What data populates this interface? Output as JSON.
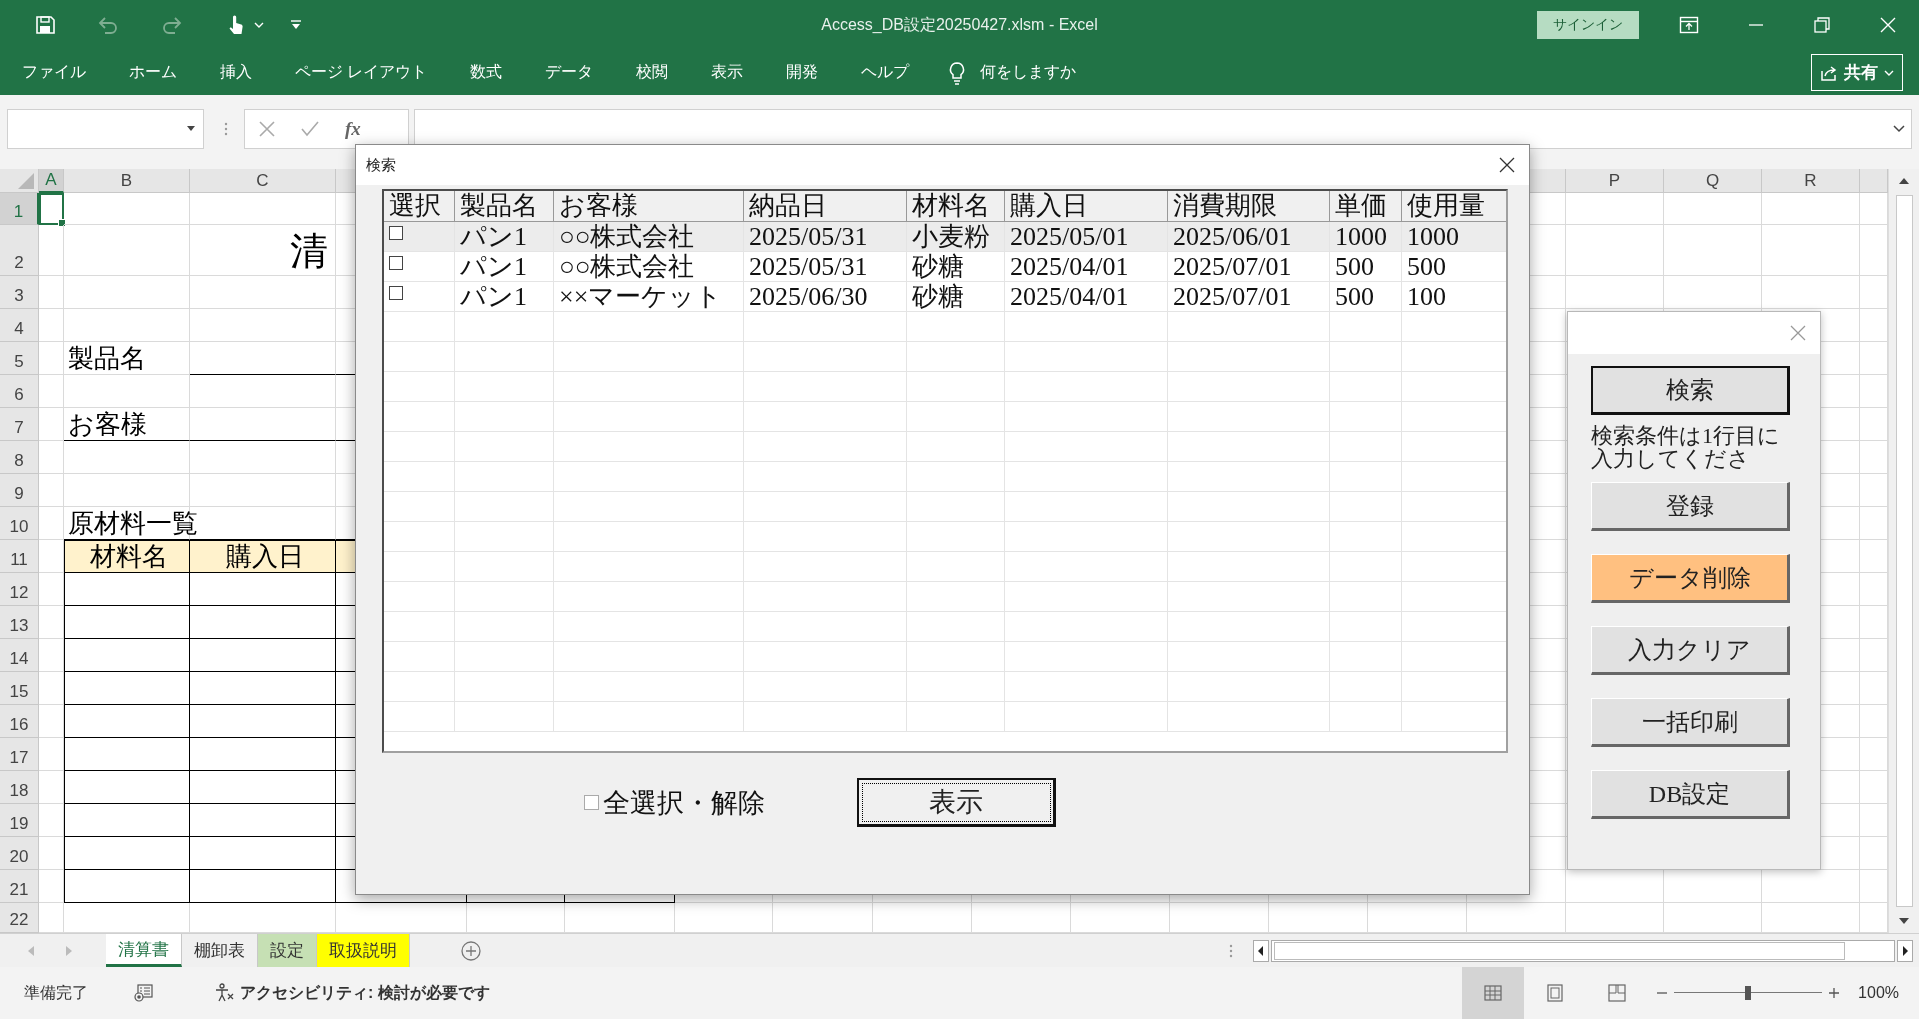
{
  "window": {
    "title": "Access_DB設定20250427.xlsm - Excel",
    "sign_in": "サインイン"
  },
  "ribbon": {
    "tabs": [
      "ファイル",
      "ホーム",
      "挿入",
      "ページ レイアウト",
      "数式",
      "データ",
      "校閲",
      "表示",
      "開発",
      "ヘルプ"
    ],
    "tell_me": "何をしますか",
    "share": "共有"
  },
  "formula_bar": {
    "function_label": "fx"
  },
  "sheet": {
    "columns_left": [
      "A",
      "B",
      "C"
    ],
    "columns_right": [
      "P",
      "Q",
      "R"
    ],
    "rows": [
      "1",
      "2",
      "3",
      "4",
      "5",
      "6",
      "7",
      "8",
      "9",
      "10",
      "11",
      "12",
      "13",
      "14",
      "15",
      "16",
      "17",
      "18",
      "19",
      "20",
      "21",
      "22"
    ],
    "title_fragment": "清",
    "product_label": "製品名",
    "customer_label": "お客様",
    "materials_heading": "原材料一覧",
    "materials_columns": [
      "材料名",
      "購入日"
    ]
  },
  "search_dialog": {
    "title": "検索",
    "checkbox_column": "選択",
    "columns": [
      "製品名",
      "お客様",
      "納品日",
      "材料名",
      "購入日",
      "消費期限",
      "単価",
      "使用量"
    ],
    "rows": [
      {
        "checked": false,
        "selected": true,
        "cells": [
          "パン1",
          "○○株式会社",
          "2025/05/31",
          "小麦粉",
          "2025/05/01",
          "2025/06/01",
          "1000",
          "1000"
        ]
      },
      {
        "checked": false,
        "selected": false,
        "cells": [
          "パン1",
          "○○株式会社",
          "2025/05/31",
          "砂糖",
          "2025/04/01",
          "2025/07/01",
          "500",
          "500"
        ]
      },
      {
        "checked": false,
        "selected": false,
        "cells": [
          "パン1",
          "××マーケット",
          "2025/06/30",
          "砂糖",
          "2025/04/01",
          "2025/07/01",
          "500",
          "100"
        ]
      }
    ],
    "select_all": {
      "label": "全選択・解除",
      "checked": false
    },
    "show_button": {
      "label": "表示",
      "focused": true
    }
  },
  "side_panel": {
    "items": [
      {
        "kind": "button",
        "label": "検索",
        "focused": true,
        "color": "#e1e1e1"
      },
      {
        "kind": "note",
        "label": "検索条件は1行目に入力してくださ"
      },
      {
        "kind": "button",
        "label": "登録",
        "focused": false,
        "color": "#e1e1e1"
      },
      {
        "kind": "button",
        "label": "データ削除",
        "focused": false,
        "color": "#ffc080"
      },
      {
        "kind": "button",
        "label": "入力クリア",
        "focused": false,
        "color": "#e1e1e1"
      },
      {
        "kind": "button",
        "label": "一括印刷",
        "focused": false,
        "color": "#e1e1e1"
      },
      {
        "kind": "button",
        "label": "DB設定",
        "focused": false,
        "color": "#e1e1e1"
      }
    ]
  },
  "sheet_tabs": [
    {
      "label": "清算書",
      "selected": true,
      "color": "#ffffff"
    },
    {
      "label": "棚卸表",
      "selected": false,
      "color": "#f0f0f0"
    },
    {
      "label": "設定",
      "selected": false,
      "color": "#c6e0b4"
    },
    {
      "label": "取扱説明",
      "selected": false,
      "color": "#ffff00"
    }
  ],
  "status_bar": {
    "ready": "準備完了",
    "accessibility": "アクセシビリティ: 検討が必要です",
    "views": [
      {
        "kind": "normal",
        "selected": true
      },
      {
        "kind": "page_layout",
        "selected": false
      },
      {
        "kind": "page_break",
        "selected": false
      }
    ],
    "zoom": {
      "level": 0.5,
      "label": "100%"
    }
  }
}
